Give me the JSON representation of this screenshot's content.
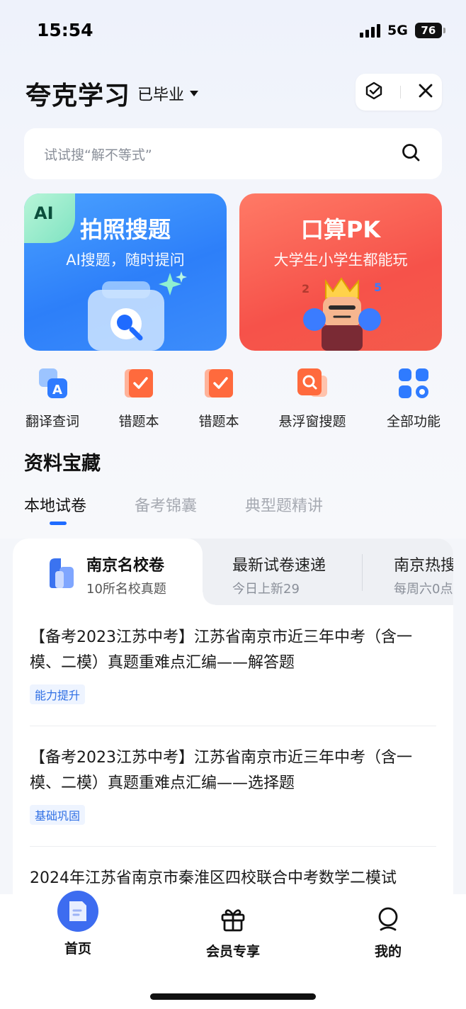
{
  "status_bar": {
    "time": "15:54",
    "network": "5G",
    "battery": "76"
  },
  "header": {
    "brand": "夸克学习",
    "grade": "已毕业"
  },
  "search": {
    "placeholder": "试试搜“解不等式”"
  },
  "feature_cards": [
    {
      "title": "拍照搜题",
      "subtitle": "AI搜题，随时提问",
      "badge": "AI",
      "color": "#2d7ff9"
    },
    {
      "title": "口算PK",
      "subtitle": "大学生小学生都能玩",
      "color": "#f6524a"
    }
  ],
  "shortcuts": [
    {
      "label": "翻译查词",
      "icon": "translate-icon"
    },
    {
      "label": "错题本",
      "icon": "mistake-book-icon"
    },
    {
      "label": "错题本",
      "icon": "mistake-book-icon"
    },
    {
      "label": "悬浮窗搜题",
      "icon": "floating-search-icon"
    },
    {
      "label": "全部功能",
      "icon": "all-features-icon"
    }
  ],
  "section": {
    "title": "资料宝藏",
    "tabs": [
      "本地试卷",
      "备考锦囊",
      "典型题精讲"
    ],
    "active_tab": 0
  },
  "subtabs": [
    {
      "title": "南京名校卷",
      "subtitle": "10所名校真题"
    },
    {
      "title": "最新试卷速递",
      "subtitle": "今日上新29"
    },
    {
      "title": "南京热搜",
      "subtitle": "每周六0点"
    }
  ],
  "articles": [
    {
      "title": "【备考2023江苏中考】江苏省南京市近三年中考（含一模、二模）真题重难点汇编——解答题",
      "tag": "能力提升"
    },
    {
      "title": "【备考2023江苏中考】江苏省南京市近三年中考（含一模、二模）真题重难点汇编——选择题",
      "tag": "基础巩固"
    },
    {
      "title": "2024年江苏省南京市秦淮区四校联合中考数学二模试"
    }
  ],
  "bottom_nav": [
    {
      "label": "首页",
      "icon": "home-icon",
      "active": true
    },
    {
      "label": "会员专享",
      "icon": "gift-icon"
    },
    {
      "label": "我的",
      "icon": "profile-icon"
    }
  ],
  "colors": {
    "accent": "#1f6bff",
    "tag_text": "#2f6fe4"
  }
}
